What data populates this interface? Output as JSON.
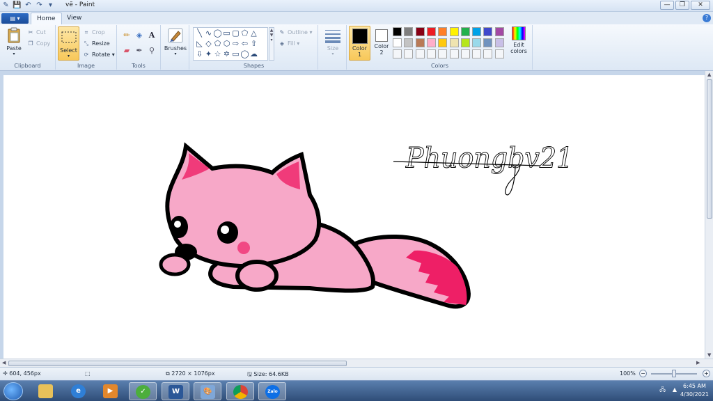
{
  "window": {
    "title": "vẽ - Paint",
    "min_label": "—",
    "max_label": "❐",
    "close_label": "✕"
  },
  "tabs": {
    "app_menu": "▤ ▾",
    "home": "Home",
    "view": "View"
  },
  "ribbon": {
    "clipboard": {
      "label": "Clipboard",
      "paste": "Paste",
      "cut": "Cut",
      "copy": "Copy"
    },
    "image": {
      "label": "Image",
      "select": "Select",
      "crop": "Crop",
      "resize": "Resize",
      "rotate": "Rotate ▾"
    },
    "tools": {
      "label": "Tools"
    },
    "brushes": {
      "label": "Brushes"
    },
    "shapes": {
      "label": "Shapes",
      "outline": "Outline ▾",
      "fill": "Fill ▾"
    },
    "size": {
      "label": "Size"
    },
    "colors": {
      "label": "Colors",
      "color1_label": "Color",
      "color1_num": "1",
      "color1_value": "#000000",
      "color2_label": "Color",
      "color2_num": "2",
      "color2_value": "#ffffff",
      "edit_colors_1": "Edit",
      "edit_colors_2": "colors",
      "palette_row1": [
        "#000000",
        "#7f7f7f",
        "#880015",
        "#ed1c24",
        "#ff7f27",
        "#fff200",
        "#22b14c",
        "#00a2e8",
        "#3f48cc",
        "#a349a4"
      ],
      "palette_row2": [
        "#ffffff",
        "#c3c3c3",
        "#b97a57",
        "#ffaec9",
        "#ffc90e",
        "#efe4b0",
        "#b5e61d",
        "#99d9ea",
        "#7092be",
        "#c8bfe7"
      ]
    }
  },
  "canvas": {
    "signature": "Phuongbv21",
    "ink": "#000000",
    "fox_pink": "#f7a8c8",
    "fox_accent": "#ee1f66"
  },
  "status": {
    "cursor_pos": "604, 456px",
    "image_size": "2720 × 1076px",
    "file_size": "Size: 64.6KB",
    "zoom": "100%"
  },
  "taskbar": {
    "clock_time": "6:45 AM",
    "clock_date": "4/30/2021",
    "word_label": "W",
    "zalo_label": "Zalo"
  }
}
